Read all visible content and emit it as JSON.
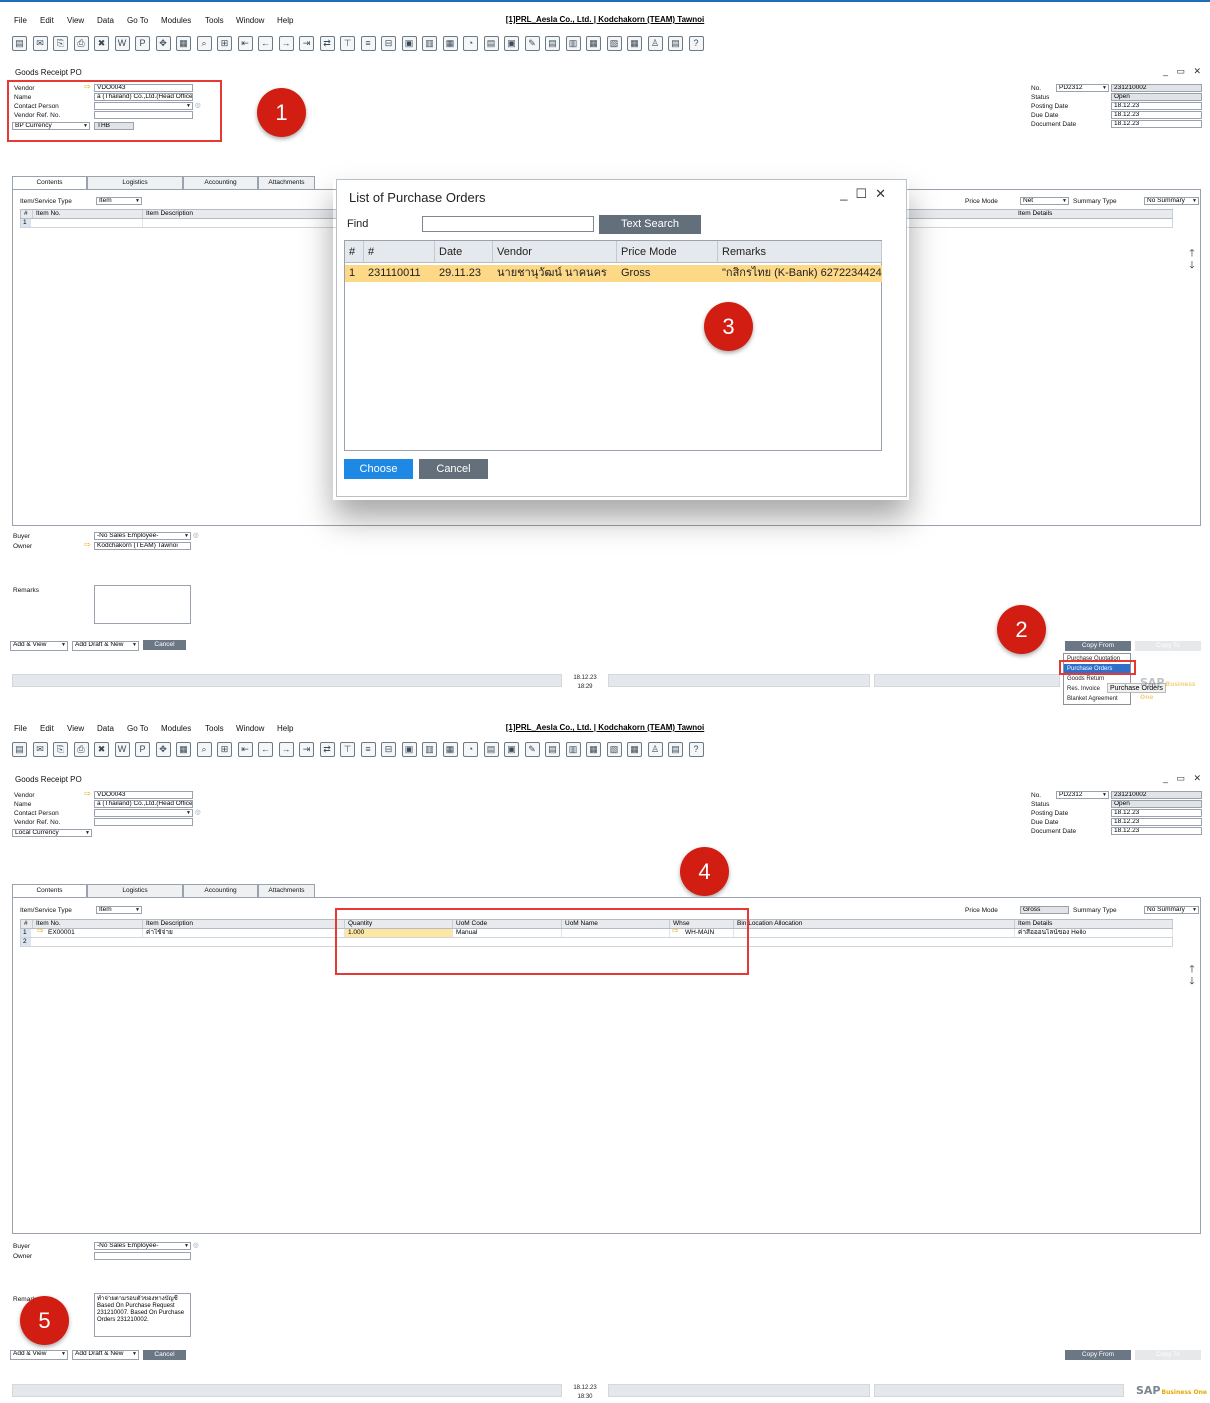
{
  "menu": [
    "File",
    "Edit",
    "View",
    "Data",
    "Go To",
    "Modules",
    "Tools",
    "Window",
    "Help"
  ],
  "window_title": "[1]PRL_Aesla Co., Ltd. | Kodchakorn (TEAM) Tawnoi",
  "toolbar_icons": [
    "preview-icon",
    "print-icon",
    "export-icon",
    "email-icon",
    "excel-icon",
    "word-icon",
    "pdf-icon",
    "move-icon",
    "form-icon",
    "find-icon",
    "add-icon",
    "first-icon",
    "prev-icon",
    "next-icon",
    "last-icon",
    "base-doc-icon",
    "filter-icon",
    "sort-icon",
    "tree-icon",
    "doc-a-icon",
    "doc-b-icon",
    "doc-c-icon",
    "chart-icon",
    "journal-icon",
    "settings-icon",
    "edit-icon",
    "doc-d-icon",
    "doc-e-icon",
    "doc-f-icon",
    "doc-g-icon",
    "calc-icon",
    "user-icon",
    "query-icon",
    "help-icon"
  ],
  "form_title": "Goods Receipt PO",
  "header": {
    "vendor_label": "Vendor",
    "vendor_value": "VDO0043",
    "name_label": "Name",
    "name_value": "a (Thailand) Co.,Ltd.(Head Office",
    "contact_label": "Contact Person",
    "vendor_ref_label": "Vendor Ref. No.",
    "no_label": "No.",
    "series_value": "PD2312",
    "doc_number": "231210002",
    "status_label": "Status",
    "status_value": "Open",
    "posting_label": "Posting Date",
    "posting_value": "18.12.23",
    "due_label": "Due Date",
    "due_value": "18.12.23",
    "docdate_label": "Document Date",
    "docdate_value": "18.12.23"
  },
  "tabs": [
    "Contents",
    "Logistics",
    "Accounting",
    "Attachments"
  ],
  "item_type_label": "Item/Service Type",
  "item_type_value": "Item",
  "price_mode_label": "Price Mode",
  "summary_type_label": "Summary Type",
  "summary_type_value": "No Summary",
  "buyer_label": "Buyer",
  "buyer_value": "-No Sales Employee-",
  "owner_label": "Owner",
  "remarks_label": "Remarks",
  "add_view_label": "Add & View",
  "add_draft_label": "Add Draft & New",
  "cancel_label": "Cancel",
  "copy_from_label": "Copy From",
  "copy_to_label": "Copy To",
  "sap_logo": "SAP",
  "sap_sub": "Business One",
  "shot1": {
    "currency_label": "BP Currency",
    "currency_value": "THB",
    "price_mode_value": "Net",
    "columns": [
      "#",
      "Item No.",
      "Item Description",
      "Item Details"
    ],
    "row_num": "1",
    "owner_value": "Kodchakorn (TEAM) Tawnoi",
    "status_date": "18.12.23",
    "status_time": "18:29",
    "badges": [
      "1",
      "2",
      "3"
    ],
    "copy_from_menu": [
      "Purchase Quotation",
      "Purchase Orders",
      "Goods Return",
      "Res. Invoice",
      "Blanket Agreement"
    ],
    "tooltip": "Purchase Orders"
  },
  "dialog": {
    "title": "List of Purchase Orders",
    "find_label": "Find",
    "search_button": "Text Search",
    "columns": [
      "#",
      "#",
      "Date",
      "Vendor",
      "Price Mode",
      "Remarks"
    ],
    "row": [
      "1",
      "231110011",
      "29.11.23",
      "นายชานุวัฒน์ นาคนคร",
      "Gross",
      "\"กสิกรไทย (K-Bank) 6272234424 ("
    ],
    "choose_button": "Choose",
    "cancel_button": "Cancel"
  },
  "shot2": {
    "currency_label": "Local Currency",
    "price_mode_value": "Gross",
    "columns": [
      "#",
      "Item No.",
      "Item Description",
      "Quantity",
      "UoM Code",
      "UoM Name",
      "Whse",
      "Bin Location Allocation",
      "Item Details"
    ],
    "row1": {
      "num": "1",
      "item_no": "EX00001",
      "desc": "ค่าใช้จ่าย",
      "qty": "1.000",
      "uom_code": "Manual",
      "uom_name": "",
      "whse": "WH-MAIN",
      "bin": "",
      "details": "ค่าสื่อออนไลน์ของ Hello"
    },
    "row2_num": "2",
    "remarks": "ทำจ่ายตามรอบตัวของทางบัญชี\nBased On Purchase Request 231210007. Based On Purchase Orders 231210002.",
    "status_date": "18.12.23",
    "status_time": "18:30",
    "badges": [
      "4",
      "5"
    ]
  },
  "colors": {
    "accent": "#1e88e5",
    "highlight_row": "#fdd987",
    "badge": "#d21d12",
    "annotation": "#e53935",
    "button": "#6b7784"
  }
}
